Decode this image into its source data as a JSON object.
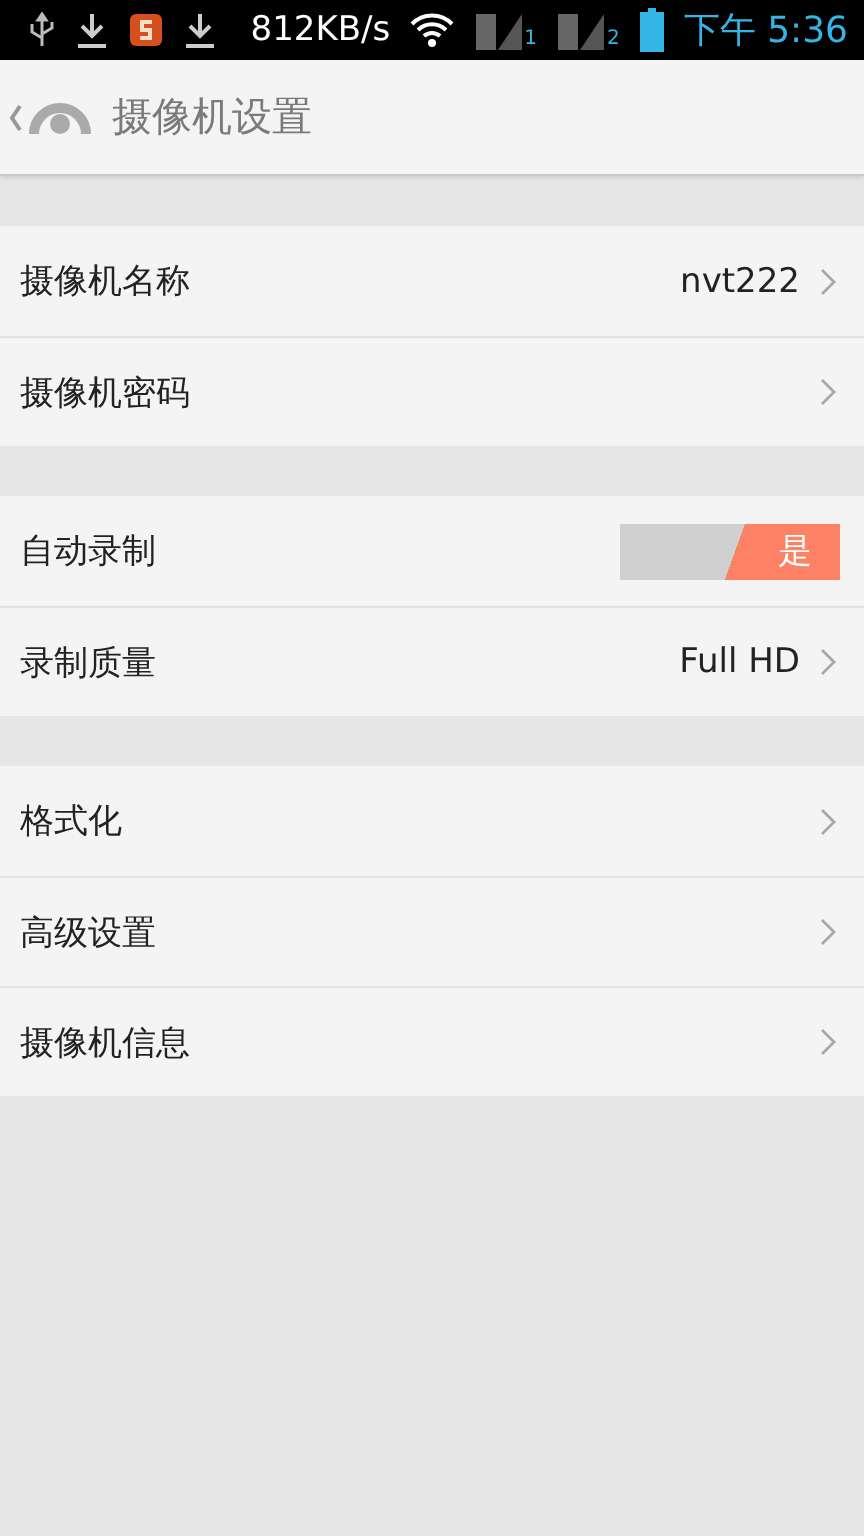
{
  "status_bar": {
    "speed": "812KB/s",
    "sim_slots": [
      "1",
      "2"
    ],
    "time": "下午 5:36"
  },
  "header": {
    "title": "摄像机设置"
  },
  "groups": [
    {
      "rows": [
        {
          "kind": "value",
          "label": "摄像机名称",
          "value": "nvt222"
        },
        {
          "kind": "value",
          "label": "摄像机密码"
        }
      ]
    },
    {
      "rows": [
        {
          "kind": "toggle",
          "label": "自动录制",
          "on": true,
          "toggle_label": "是"
        },
        {
          "kind": "value",
          "label": "录制质量",
          "value": "Full HD"
        }
      ]
    },
    {
      "rows": [
        {
          "kind": "value",
          "label": "格式化"
        },
        {
          "kind": "value",
          "label": "高级设置"
        },
        {
          "kind": "value",
          "label": "摄像机信息"
        }
      ]
    }
  ]
}
